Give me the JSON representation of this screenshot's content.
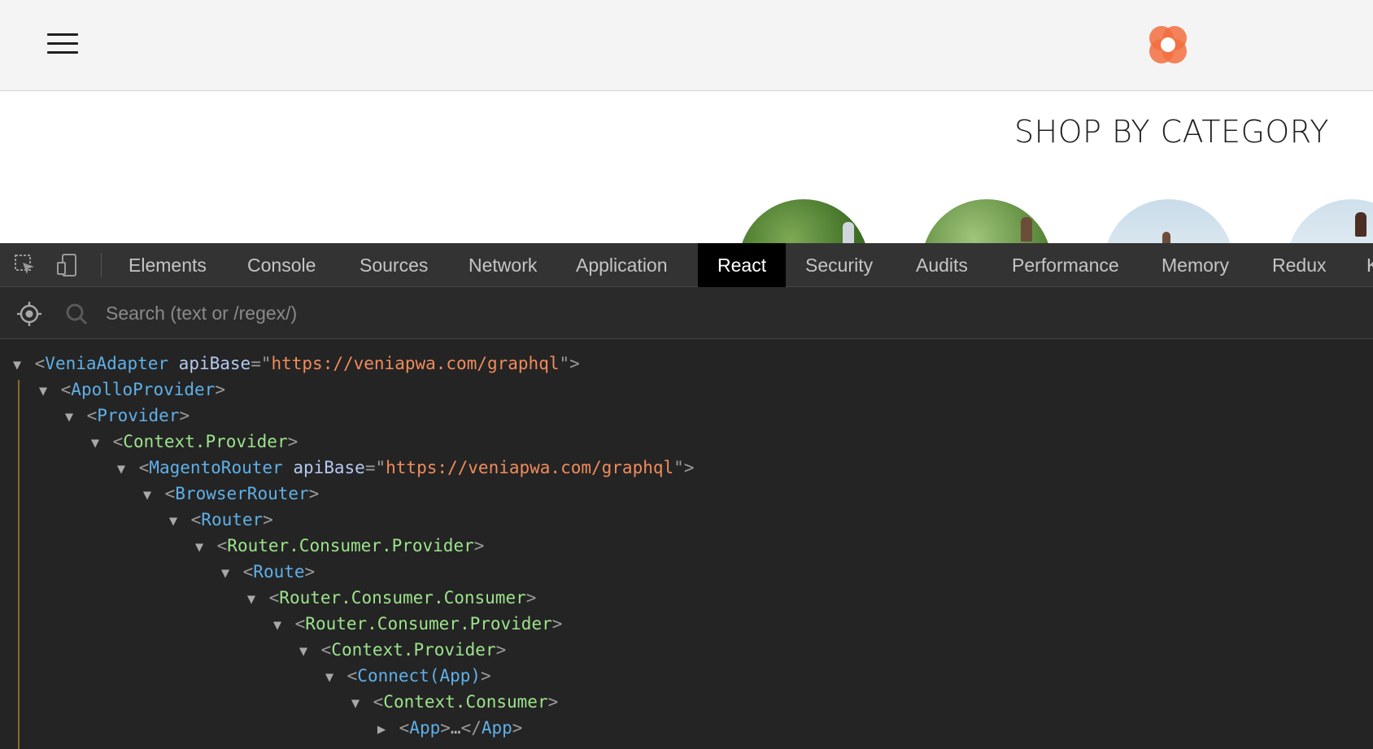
{
  "site": {
    "shop_title": "SHOP BY CATEGORY",
    "brand_color": "#f26f3e"
  },
  "devtools": {
    "tabs": [
      "Elements",
      "Console",
      "Sources",
      "Network",
      "Application",
      "React",
      "Security",
      "Audits",
      "Performance",
      "Memory",
      "Redux",
      "K"
    ],
    "active_tab": "React",
    "search_placeholder": "Search (text or /regex/)",
    "colors": {
      "composite_tag": "#5fb0e8",
      "host_tag": "#9de38c",
      "attr_name": "#b4c8f0",
      "attr_value": "#f08c5c",
      "guide_line": "#8a6a2e"
    },
    "tree": [
      {
        "depth": 0,
        "arrow": "▼",
        "tag": "VeniaAdapter",
        "kind": "composite",
        "attr": "apiBase",
        "value": "https://veniapwa.com/graphql"
      },
      {
        "depth": 1,
        "arrow": "▼",
        "tag": "ApolloProvider",
        "kind": "composite"
      },
      {
        "depth": 2,
        "arrow": "▼",
        "tag": "Provider",
        "kind": "composite"
      },
      {
        "depth": 3,
        "arrow": "▼",
        "tag": "Context.Provider",
        "kind": "host"
      },
      {
        "depth": 4,
        "arrow": "▼",
        "tag": "MagentoRouter",
        "kind": "composite",
        "attr": "apiBase",
        "value": "https://veniapwa.com/graphql"
      },
      {
        "depth": 5,
        "arrow": "▼",
        "tag": "BrowserRouter",
        "kind": "composite"
      },
      {
        "depth": 6,
        "arrow": "▼",
        "tag": "Router",
        "kind": "composite"
      },
      {
        "depth": 7,
        "arrow": "▼",
        "tag": "Router.Consumer.Provider",
        "kind": "host"
      },
      {
        "depth": 8,
        "arrow": "▼",
        "tag": "Route",
        "kind": "composite"
      },
      {
        "depth": 9,
        "arrow": "▼",
        "tag": "Router.Consumer.Consumer",
        "kind": "host"
      },
      {
        "depth": 10,
        "arrow": "▼",
        "tag": "Router.Consumer.Provider",
        "kind": "host"
      },
      {
        "depth": 11,
        "arrow": "▼",
        "tag": "Context.Provider",
        "kind": "host"
      },
      {
        "depth": 12,
        "arrow": "▼",
        "tag": "Connect(App)",
        "kind": "composite"
      },
      {
        "depth": 13,
        "arrow": "▼",
        "tag": "Context.Consumer",
        "kind": "host"
      },
      {
        "depth": 14,
        "arrow": "▶",
        "tag": "App",
        "kind": "composite",
        "collapsed": true,
        "ellipsis": "…"
      }
    ]
  }
}
